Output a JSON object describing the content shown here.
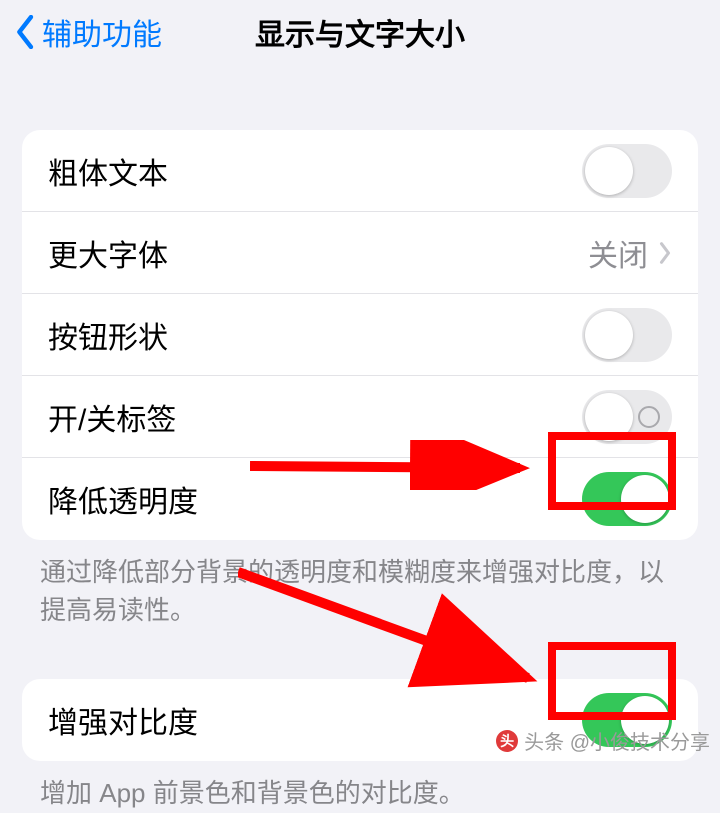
{
  "header": {
    "back_label": "辅助功能",
    "title": "显示与文字大小"
  },
  "group1": {
    "bold_text": {
      "label": "粗体文本",
      "checked": false,
      "show_ring": false
    },
    "larger_text": {
      "label": "更大字体",
      "value": "关闭"
    },
    "button_shapes": {
      "label": "按钮形状",
      "checked": false,
      "show_ring": false
    },
    "on_off_labels": {
      "label": "开/关标签",
      "checked": false,
      "show_ring": true
    },
    "reduce_transparency": {
      "label": "降低透明度",
      "checked": true
    }
  },
  "footer1": "通过降低部分背景的透明度和模糊度来增强对比度，以提高易读性。",
  "group2": {
    "increase_contrast": {
      "label": "增强对比度",
      "checked": true
    }
  },
  "footer2": "增加 App 前景色和背景色的对比度。",
  "watermark": "头条 @小俊技术分享",
  "colors": {
    "accent": "#007aff",
    "toggle_on": "#34c759",
    "highlight": "#ff0000"
  }
}
